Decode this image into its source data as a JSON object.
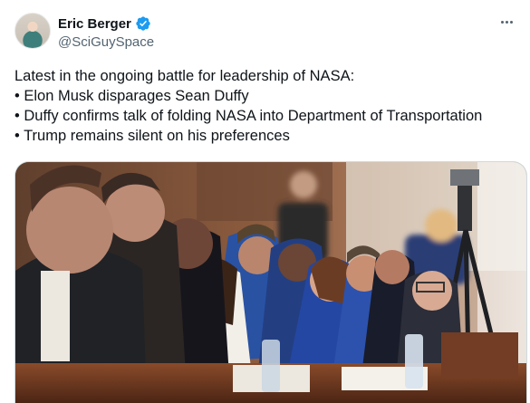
{
  "author": {
    "display_name": "Eric Berger",
    "handle": "@SciGuySpace",
    "avatar_icon": "avatar-photo",
    "verified_icon": "verified-badge-icon",
    "verified_color": "#1d9bf0"
  },
  "menu": {
    "icon": "more-options-icon"
  },
  "tweet": {
    "lines": [
      "Latest in the ongoing battle for leadership of NASA:",
      "• Elon Musk disparages Sean Duffy",
      "• Duffy confirms talk of folding NASA into Department of Transportation",
      "• Trump remains silent on his preferences"
    ]
  },
  "media": {
    "type": "photo",
    "icon": "photo-image"
  },
  "colors": {
    "text": "#0f1419",
    "secondary": "#536471",
    "border": "#cfd9de"
  }
}
